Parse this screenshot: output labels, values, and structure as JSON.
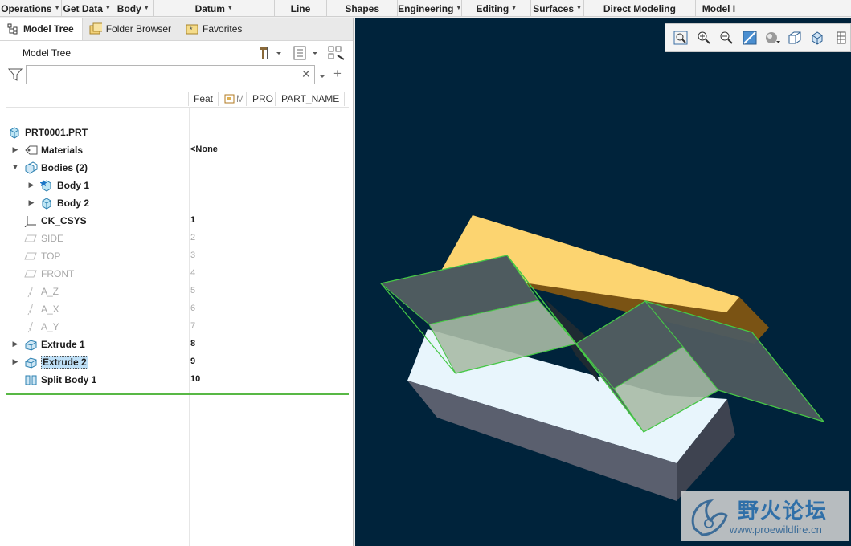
{
  "ribbon": {
    "groups": [
      {
        "label": "Operations",
        "dropdown": true
      },
      {
        "label": "Get Data",
        "dropdown": true
      },
      {
        "label": "Body",
        "dropdown": true
      },
      {
        "label": "Datum",
        "dropdown": true
      },
      {
        "label": "Line",
        "dropdown": false
      },
      {
        "label": "Shapes",
        "dropdown": false
      },
      {
        "label": "Engineering",
        "dropdown": true
      },
      {
        "label": "Editing",
        "dropdown": true
      },
      {
        "label": "Surfaces",
        "dropdown": true
      },
      {
        "label": "Direct Modeling",
        "dropdown": false
      },
      {
        "label": "Model I",
        "dropdown": false
      }
    ]
  },
  "tabs": [
    {
      "label": "Model Tree",
      "icon": "model-tree-icon",
      "active": true
    },
    {
      "label": "Folder Browser",
      "icon": "folder-browser-icon",
      "active": false
    },
    {
      "label": "Favorites",
      "icon": "favorites-icon",
      "active": false
    }
  ],
  "tree_header": {
    "title": "Model Tree"
  },
  "filter": {
    "value": "",
    "placeholder": ""
  },
  "columns": [
    "Feat",
    "M",
    "PRO",
    "PART_NAME"
  ],
  "tree": [
    {
      "label": "PRT0001.PRT",
      "icon": "part-icon",
      "arrow": "",
      "indent": 0,
      "feat": "",
      "dim": false
    },
    {
      "label": "Materials",
      "icon": "materials-icon",
      "arrow": "▶",
      "indent": 1,
      "feat": "<None",
      "dim": false
    },
    {
      "label": "Bodies (2)",
      "icon": "bodies-icon",
      "arrow": "▼",
      "indent": 1,
      "feat": "",
      "dim": false
    },
    {
      "label": "Body 1",
      "icon": "body-default-icon",
      "arrow": "▶",
      "indent": 2,
      "feat": "",
      "dim": false
    },
    {
      "label": "Body 2",
      "icon": "body-icon",
      "arrow": "▶",
      "indent": 2,
      "feat": "",
      "dim": false
    },
    {
      "label": "CK_CSYS",
      "icon": "csys-icon",
      "arrow": "",
      "indent": 1,
      "feat": "1",
      "dim": false
    },
    {
      "label": "SIDE",
      "icon": "datum-plane-icon",
      "arrow": "",
      "indent": 1,
      "feat": "2",
      "dim": true
    },
    {
      "label": "TOP",
      "icon": "datum-plane-icon",
      "arrow": "",
      "indent": 1,
      "feat": "3",
      "dim": true
    },
    {
      "label": "FRONT",
      "icon": "datum-plane-icon",
      "arrow": "",
      "indent": 1,
      "feat": "4",
      "dim": true
    },
    {
      "label": "A_Z",
      "icon": "datum-axis-icon",
      "arrow": "",
      "indent": 1,
      "feat": "5",
      "dim": true
    },
    {
      "label": "A_X",
      "icon": "datum-axis-icon",
      "arrow": "",
      "indent": 1,
      "feat": "6",
      "dim": true
    },
    {
      "label": "A_Y",
      "icon": "datum-axis-icon",
      "arrow": "",
      "indent": 1,
      "feat": "7",
      "dim": true
    },
    {
      "label": "Extrude 1",
      "icon": "extrude-icon",
      "arrow": "▶",
      "indent": 1,
      "feat": "8",
      "dim": false
    },
    {
      "label": "Extrude 2",
      "icon": "extrude-icon",
      "arrow": "▶",
      "indent": 1,
      "feat": "9",
      "dim": false,
      "selected": true
    },
    {
      "label": "Split Body 1",
      "icon": "split-body-icon",
      "arrow": "",
      "indent": 1,
      "feat": "10",
      "dim": false
    }
  ],
  "view_toolbar": [
    "zoom-fit-icon",
    "zoom-in-icon",
    "zoom-out-icon",
    "repaint-icon",
    "display-style-icon",
    "saved-views-icon",
    "view-orient-icon",
    "more-icon"
  ],
  "watermark": {
    "text_cn": "野火论坛",
    "url": "www.proewildfire.cn"
  },
  "colors": {
    "viewport_bg": "#00233b",
    "solid_top": "#fcd470",
    "box_top": "#e8f5fc",
    "quilt_edge": "#46c846",
    "selection": "#bfe0f7"
  }
}
